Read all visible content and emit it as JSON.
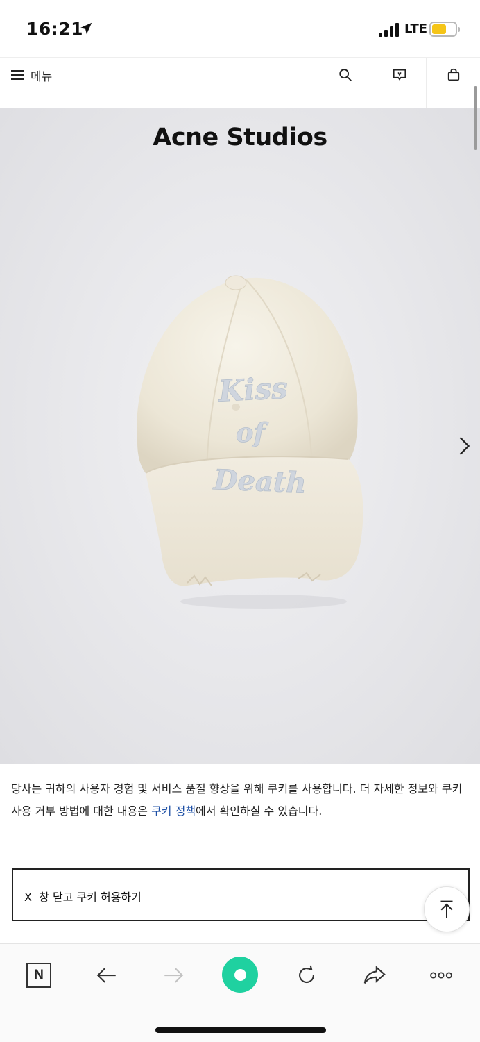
{
  "status_bar": {
    "time": "16:21",
    "network": "LTE",
    "battery_color": "#f5c518"
  },
  "header": {
    "menu_label": "메뉴",
    "icons": [
      "search-icon",
      "chat-icon",
      "bag-icon"
    ]
  },
  "hero": {
    "brand": "Acne Studios",
    "product_embroidery": "Kiss of Death",
    "next_icon": "chevron-right-icon"
  },
  "cookie": {
    "text_before_link": "당사는 귀하의 사용자 경험 및 서비스 품질 향상을 위해 쿠키를 사용합니다. 더 자세한 정보와 쿠키 사용 거부 방법에 대한 내용은 ",
    "link_text": "쿠키 정책",
    "text_after_link": "에서 확인하실 수 있습니다.",
    "close_label": "X  창 닫고 쿠키 허용하기",
    "link_color": "#1d4fa5"
  },
  "browser_toolbar": {
    "naver_label": "N",
    "icons": [
      "naver-icon",
      "back-icon",
      "forward-icon",
      "home-icon",
      "reload-icon",
      "share-icon",
      "more-icon"
    ],
    "accent": "#1fd1a0"
  }
}
